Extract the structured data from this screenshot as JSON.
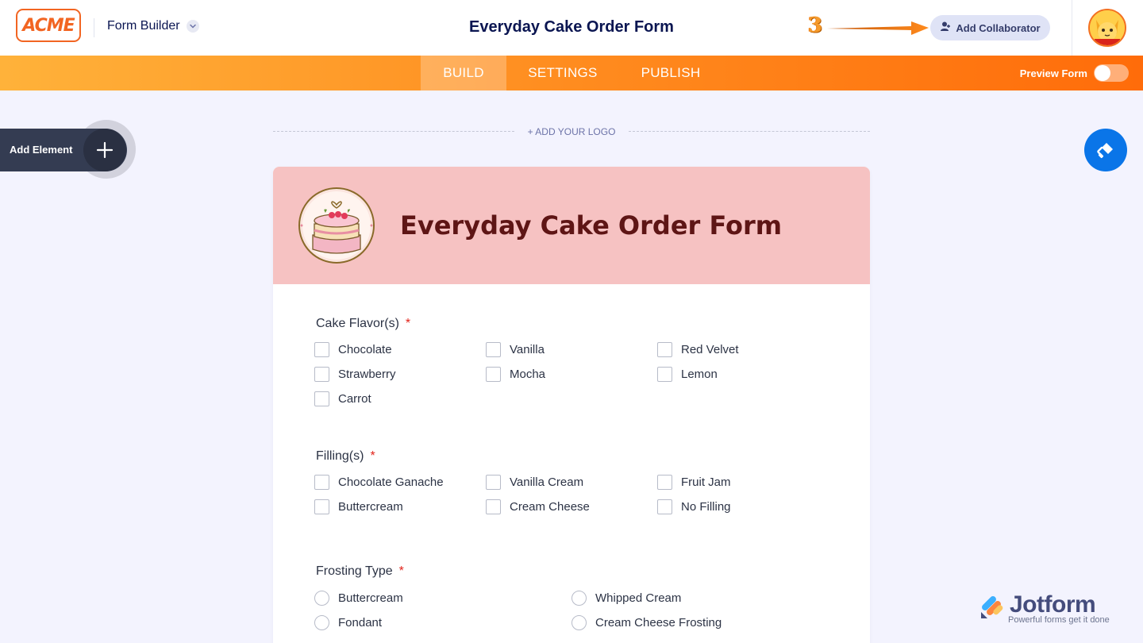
{
  "header": {
    "brand_logo": "ACME",
    "app_switcher_label": "Form Builder",
    "form_title": "Everyday Cake Order Form",
    "step_number": "3",
    "collaborator_button": "Add Collaborator"
  },
  "nav": {
    "tabs": [
      {
        "label": "BUILD",
        "active": true
      },
      {
        "label": "SETTINGS",
        "active": false
      },
      {
        "label": "PUBLISH",
        "active": false
      }
    ],
    "preview_label": "Preview Form",
    "preview_on": false
  },
  "sidebar": {
    "add_element_label": "Add Element"
  },
  "canvas": {
    "add_logo_label": "+ ADD YOUR LOGO"
  },
  "form": {
    "title": "Everyday Cake Order Form",
    "header_color": "#f6c2c2",
    "title_color": "#5e1515",
    "questions": [
      {
        "label": "Cake Flavor(s)",
        "required": "*",
        "type": "checkbox",
        "options": [
          "Chocolate",
          "Vanilla",
          "Red Velvet",
          "Strawberry",
          "Mocha",
          "Lemon",
          "Carrot"
        ]
      },
      {
        "label": "Filling(s)",
        "required": "*",
        "type": "checkbox",
        "options": [
          "Chocolate Ganache",
          "Vanilla Cream",
          "Fruit Jam",
          "Buttercream",
          "Cream Cheese",
          "No Filling"
        ]
      },
      {
        "label": "Frosting Type",
        "required": "*",
        "type": "radio",
        "options": [
          "Buttercream",
          "Whipped Cream",
          "Fondant",
          "Cream Cheese Frosting"
        ]
      }
    ]
  },
  "watermark": {
    "name": "Jotform",
    "tagline": "Powerful forms get it done"
  },
  "colors": {
    "accent_orange": "#ff7a12",
    "brand_orange": "#f26522",
    "primary_blue": "#0a75e8",
    "navy": "#0a1551"
  }
}
